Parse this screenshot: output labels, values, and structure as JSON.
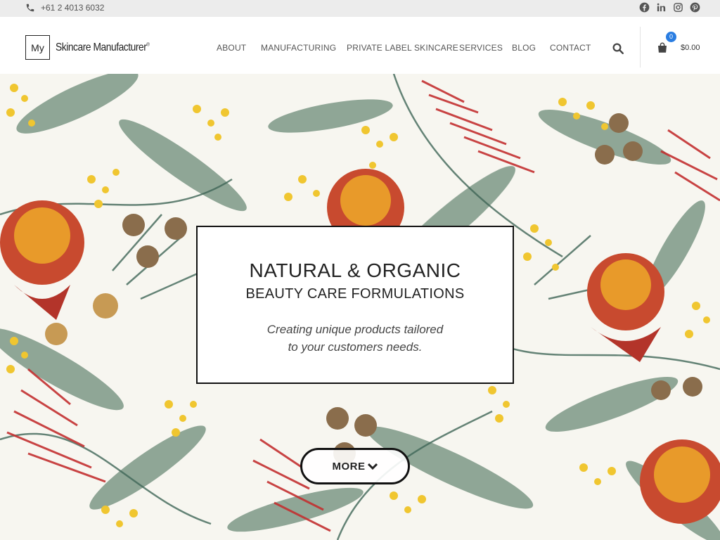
{
  "topbar": {
    "phone": "+61 2 4013 6032",
    "phone_icon": "phone-icon",
    "social": [
      {
        "name": "facebook-icon"
      },
      {
        "name": "linkedin-icon"
      },
      {
        "name": "instagram-icon"
      },
      {
        "name": "pinterest-icon"
      }
    ]
  },
  "header": {
    "logo_box": "My",
    "logo_text": "Skincare Manufacturer",
    "logo_mark": "®",
    "nav": [
      "ABOUT",
      "MANUFACTURING",
      "PRIVATE LABEL SKINCARE",
      "SERVICES",
      "BLOG",
      "CONTACT"
    ],
    "search_icon": "search-icon",
    "cart_icon": "shopping-bag-icon",
    "cart_count": "0",
    "cart_total": "$0.00"
  },
  "hero": {
    "title": "NATURAL & ORGANIC",
    "subtitle": "BEAUTY CARE FORMULATIONS",
    "tagline_1": "Creating unique products tailored",
    "tagline_2": "to your customers needs.",
    "more_label": "MORE",
    "more_icon": "chevron-down-icon"
  },
  "colors": {
    "topbar_bg": "#ececec",
    "accent_blue": "#2a7de1",
    "floral_red": "#c33030",
    "floral_yellow": "#f0c630",
    "leaf_green": "#6f8f7a"
  }
}
